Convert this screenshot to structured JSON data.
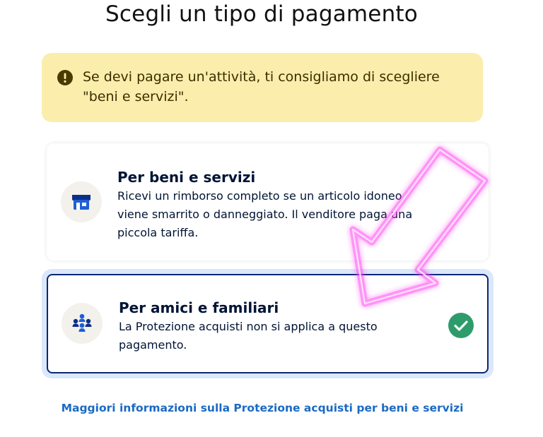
{
  "page": {
    "title": "Scegli un tipo di pagamento"
  },
  "warning": {
    "icon": "exclamation-icon",
    "text": "Se devi pagare un'attività, ti consigliamo di scegliere \"beni e servizi\"."
  },
  "options": [
    {
      "icon": "storefront-icon",
      "title": "Per beni e servizi",
      "description": "Ricevi un rimborso completo se un articolo idoneo viene smarrito o danneggiato. Il venditore paga una piccola tariffa.",
      "selected": false
    },
    {
      "icon": "people-group-icon",
      "title": "Per amici e familiari",
      "description": "La Protezione acquisti non si applica a questo pagamento.",
      "selected": true
    }
  ],
  "link": {
    "text": "Maggiori informazioni sulla Protezione acquisti per beni e servizi"
  },
  "colors": {
    "warning_bg": "#fbedab",
    "selected_border": "#0a2774",
    "check_green": "#2e9b6a",
    "link_blue": "#1b6ac4",
    "annotation_arrow": "#ff3cf0"
  }
}
